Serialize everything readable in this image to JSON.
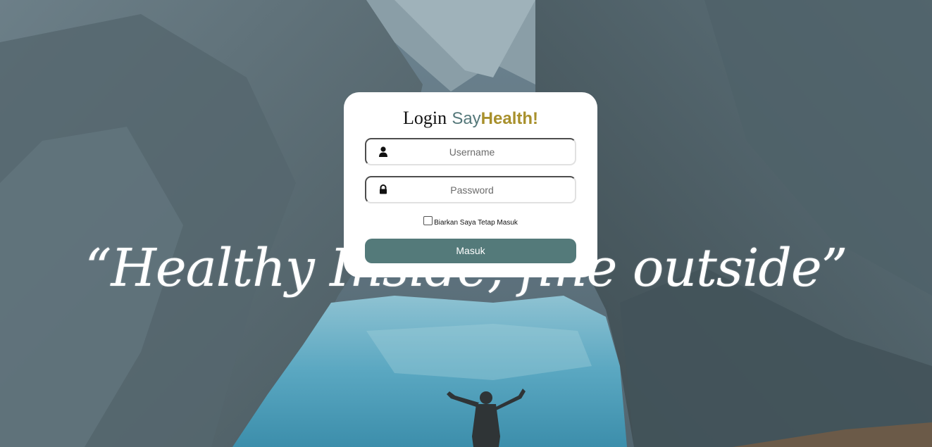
{
  "title": {
    "login": "Login",
    "say": "Say",
    "health": "Health!"
  },
  "form": {
    "username_placeholder": "Username",
    "password_placeholder": "Password",
    "username_icon": "user-icon",
    "password_icon": "lock-icon",
    "remember_label": "Biarkan Saya Tetap Masuk",
    "submit_label": "Masuk"
  },
  "background": {
    "quote": "“Healthy Inside, fine outside”"
  },
  "colors": {
    "say": "#55787a",
    "health": "#a8902c",
    "button": "#547a7a"
  }
}
